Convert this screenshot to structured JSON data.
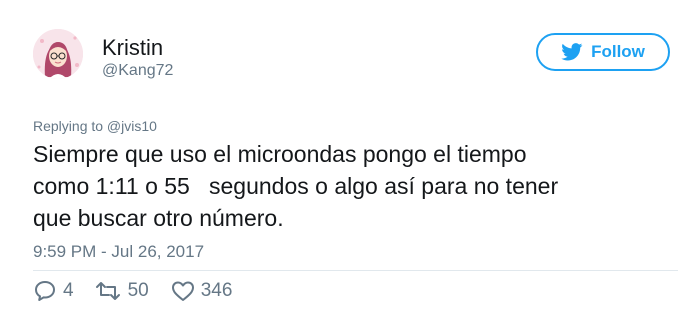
{
  "user": {
    "name": "Kristin",
    "handle": "@Kang72"
  },
  "follow_button": {
    "label": "Follow"
  },
  "tweet": {
    "replying_to": "Replying to @jvis10",
    "text": "Siempre que uso el microondas pongo el tiempo\ncomo 1:11 o 55   segundos o algo así para no tener\nque buscar otro número.",
    "timestamp": "9:59 PM - Jul 26, 2017"
  },
  "actions": {
    "replies": "4",
    "retweets": "50",
    "likes": "346"
  },
  "colors": {
    "brand": "#1da1f2",
    "secondary_text": "#657786",
    "divider": "#e1e8ed"
  }
}
